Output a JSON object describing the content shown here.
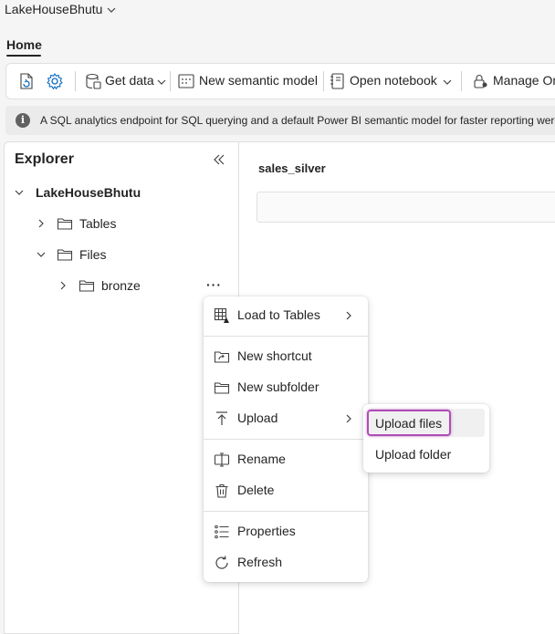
{
  "workspace": {
    "name": "LakeHouseBhutu"
  },
  "tabs": [
    {
      "label": "Home",
      "active": true
    }
  ],
  "toolbar": {
    "get_data_label": "Get data",
    "new_semantic_model_label": "New semantic model",
    "open_notebook_label": "Open notebook",
    "manage_label": "Manage On"
  },
  "infobar": {
    "message": "A SQL analytics endpoint for SQL querying and a default Power BI semantic model for faster reporting were"
  },
  "explorer": {
    "title": "Explorer",
    "root": "LakeHouseBhutu",
    "tables_label": "Tables",
    "files_label": "Files",
    "bronze_label": "bronze",
    "more_label": "···"
  },
  "canvas": {
    "table_title": "sales_silver"
  },
  "context_menu": {
    "load_to_tables": "Load to Tables",
    "new_shortcut": "New shortcut",
    "new_subfolder": "New subfolder",
    "upload": "Upload",
    "rename": "Rename",
    "delete": "Delete",
    "properties": "Properties",
    "refresh": "Refresh"
  },
  "upload_submenu": {
    "upload_files": "Upload files",
    "upload_folder": "Upload folder"
  },
  "colors": {
    "accent": "#0f6cbd",
    "highlight": "#b04bb7",
    "icon": "#424242"
  }
}
